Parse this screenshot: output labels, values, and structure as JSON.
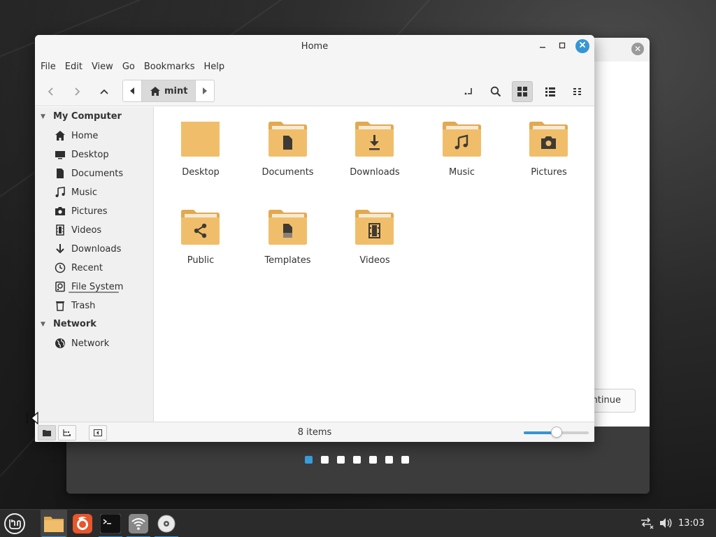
{
  "window": {
    "title": "Home",
    "controls": {
      "minimize": "–",
      "maximize": "□",
      "close": "✕"
    }
  },
  "menubar": [
    "File",
    "Edit",
    "View",
    "Go",
    "Bookmarks",
    "Help"
  ],
  "pathbar": {
    "current": "mint"
  },
  "sidebar": {
    "sections": [
      {
        "header": "My Computer",
        "items": [
          {
            "label": "Home",
            "icon": "home-icon"
          },
          {
            "label": "Desktop",
            "icon": "desktop-icon"
          },
          {
            "label": "Documents",
            "icon": "document-icon"
          },
          {
            "label": "Music",
            "icon": "music-icon"
          },
          {
            "label": "Pictures",
            "icon": "camera-icon"
          },
          {
            "label": "Videos",
            "icon": "film-icon"
          },
          {
            "label": "Downloads",
            "icon": "download-icon"
          },
          {
            "label": "Recent",
            "icon": "clock-icon"
          },
          {
            "label": "File System",
            "icon": "drive-icon"
          },
          {
            "label": "Trash",
            "icon": "trash-icon"
          }
        ]
      },
      {
        "header": "Network",
        "items": [
          {
            "label": "Network",
            "icon": "globe-icon"
          }
        ]
      }
    ]
  },
  "files": [
    {
      "name": "Desktop",
      "icon": "folder-icon"
    },
    {
      "name": "Documents",
      "icon": "folder-documents-icon"
    },
    {
      "name": "Downloads",
      "icon": "folder-downloads-icon"
    },
    {
      "name": "Music",
      "icon": "folder-music-icon"
    },
    {
      "name": "Pictures",
      "icon": "folder-pictures-icon"
    },
    {
      "name": "Public",
      "icon": "folder-public-icon"
    },
    {
      "name": "Templates",
      "icon": "folder-templates-icon"
    },
    {
      "name": "Videos",
      "icon": "folder-videos-icon"
    }
  ],
  "statusbar": {
    "text": "8 items",
    "zoom_fraction": 0.5
  },
  "background_window": {
    "button_label": "ntinue",
    "slide_count": 7,
    "active_slide": 0
  },
  "taskbar": {
    "clock": "13:03"
  },
  "colors": {
    "accent": "#3596d6",
    "folder": "#f0be6a",
    "folder_dark": "#e2a94f",
    "folder_paper": "#f5ead5",
    "folder_glyph": "#3f3a33"
  }
}
